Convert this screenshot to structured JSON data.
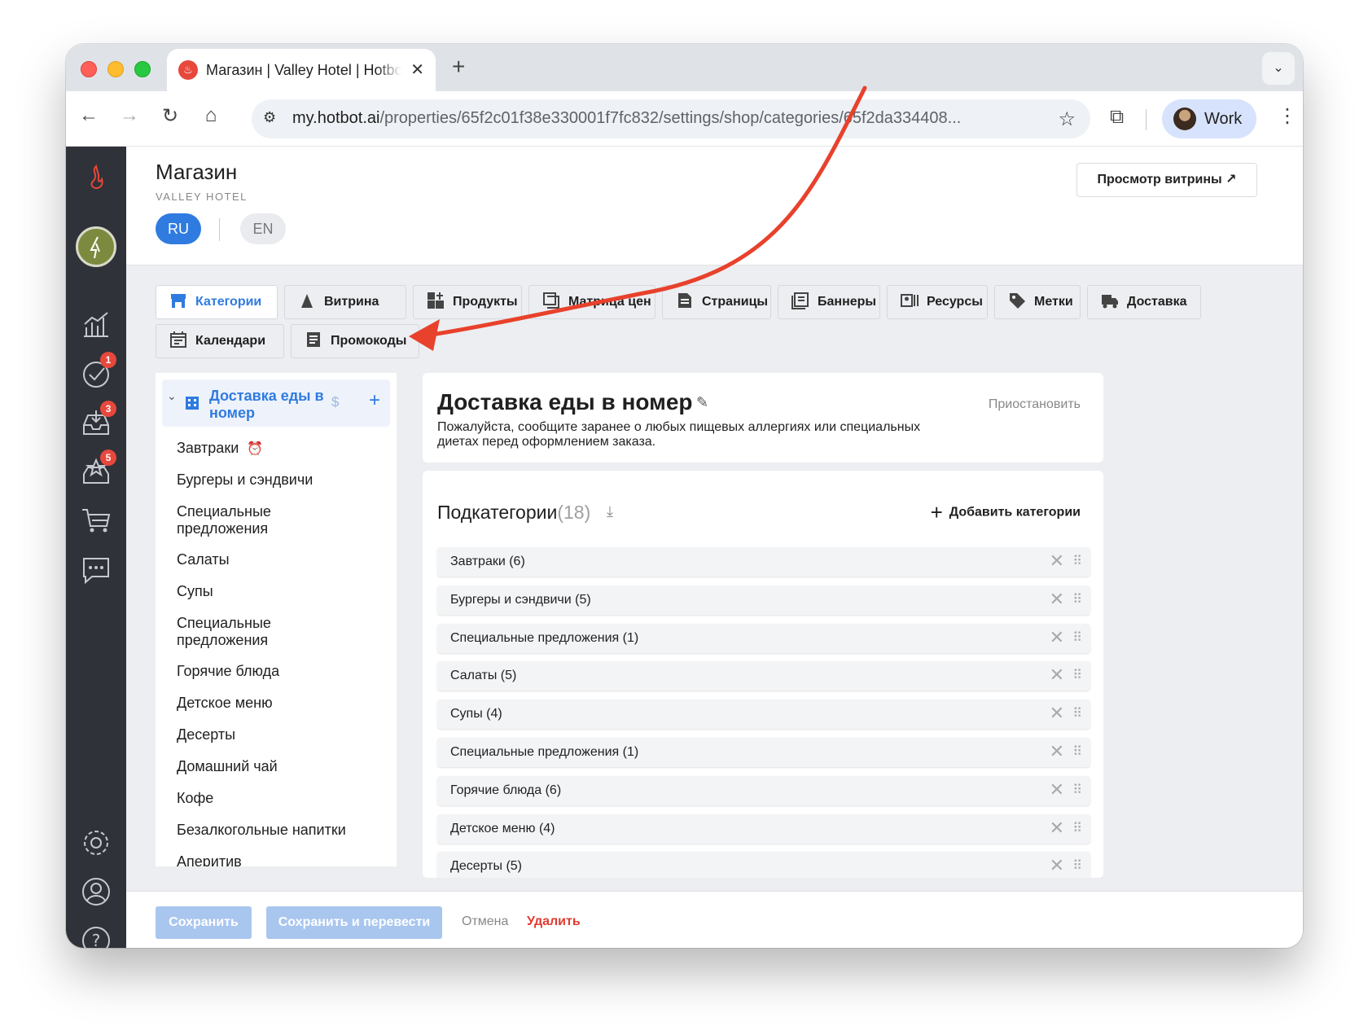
{
  "browser": {
    "tab_title": "Магазин | Valley Hotel | Hotbot",
    "url_host": "my.hotbot.ai",
    "url_path": "/properties/65f2c01f38e330001f7fc832/settings/shop/categories/65f2da334408...",
    "profile_name": "Work"
  },
  "rail": {
    "badges": {
      "tasks": "1",
      "inbox": "3",
      "reviews": "5"
    }
  },
  "header": {
    "title": "Магазин",
    "subtitle": "VALLEY HOTEL",
    "preview_button": "Просмотр витрины ↗"
  },
  "languages": {
    "ru": "RU",
    "en": "EN"
  },
  "tabs": [
    {
      "label": "Категории",
      "icon": "storefront-icon"
    },
    {
      "label": "Витрина",
      "icon": "layers-icon"
    },
    {
      "label": "Продукты",
      "icon": "grid-plus-icon"
    },
    {
      "label": "Матрица цен",
      "icon": "matrix-icon"
    },
    {
      "label": "Страницы",
      "icon": "page-icon"
    },
    {
      "label": "Баннеры",
      "icon": "banner-icon"
    },
    {
      "label": "Ресурсы",
      "icon": "resource-icon"
    },
    {
      "label": "Метки",
      "icon": "tag-icon"
    },
    {
      "label": "Доставка",
      "icon": "truck-icon"
    },
    {
      "label": "Календари",
      "icon": "calendar-icon"
    },
    {
      "label": "Промокоды",
      "icon": "promo-icon"
    }
  ],
  "tree": {
    "root_label": "Доставка еды в номер",
    "items": [
      "Завтраки",
      "Бургеры и сэндвичи",
      "Специальные предложения",
      "Салаты",
      "Супы",
      "Специальные предложения",
      "Горячие блюда",
      "Детское меню",
      "Десерты",
      "Домашний чай",
      "Кофе",
      "Безалкогольные напитки",
      "Аперитив"
    ]
  },
  "category": {
    "title": "Доставка еды в номер",
    "pause": "Приостановить",
    "description": "Пожалуйста, сообщите заранее о любых пищевых аллергиях или специальных диетах перед оформлением заказа."
  },
  "subcategories": {
    "heading": "Подкатегории",
    "count": "(18)",
    "add_label": "Добавить категории",
    "rows": [
      "Завтраки (6)",
      "Бургеры и сэндвичи (5)",
      "Специальные предложения (1)",
      "Салаты (5)",
      "Супы (4)",
      "Специальные предложения (1)",
      "Горячие блюда (6)",
      "Детское меню (4)",
      "Десерты (5)"
    ]
  },
  "footer": {
    "save": "Сохранить",
    "save_translate": "Сохранить и перевести",
    "cancel": "Отмена",
    "delete": "Удалить"
  },
  "colors": {
    "accent": "#2f7be0",
    "rail": "#2f3239",
    "danger": "#e03b30",
    "annotation_arrow": "#e8412c"
  }
}
